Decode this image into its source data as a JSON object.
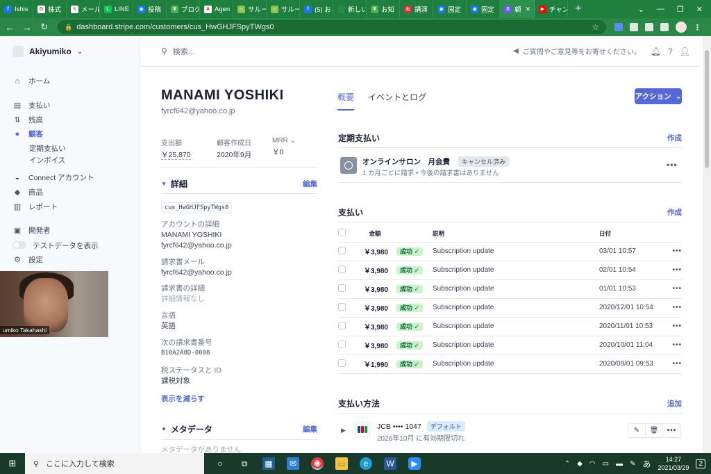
{
  "browser": {
    "tabs": [
      {
        "label": "Ishis",
        "fav_color": "#1877f2",
        "fav_glyph": "f"
      },
      {
        "label": "株式",
        "fav_color": "#ffffff",
        "fav_glyph": "G"
      },
      {
        "label": "メール",
        "fav_color": "#ffffff",
        "fav_glyph": "✎"
      },
      {
        "label": "LINE",
        "fav_color": "#06c755",
        "fav_glyph": "L"
      },
      {
        "label": "投稿",
        "fav_color": "#1877f2",
        "fav_glyph": "◉"
      },
      {
        "label": "ブログ",
        "fav_color": "#4caf50",
        "fav_glyph": "♜"
      },
      {
        "label": "Agen",
        "fav_color": "#ffffff",
        "fav_glyph": "A"
      },
      {
        "label": "サルー",
        "fav_color": "#8bc34a",
        "fav_glyph": "☺"
      },
      {
        "label": "サルー",
        "fav_color": "#8bc34a",
        "fav_glyph": "☺"
      },
      {
        "label": "(5) お",
        "fav_color": "#1877f2",
        "fav_glyph": "f"
      },
      {
        "label": "新しいタブ",
        "fav_color": "#2b8748",
        "fav_glyph": ""
      },
      {
        "label": "お知",
        "fav_color": "#4caf50",
        "fav_glyph": "♜"
      },
      {
        "label": "講演",
        "fav_color": "#d32f2f",
        "fav_glyph": "火"
      },
      {
        "label": "固定",
        "fav_color": "#1877f2",
        "fav_glyph": "◉"
      },
      {
        "label": "固定",
        "fav_color": "#1877f2",
        "fav_glyph": "◉"
      },
      {
        "label": "顧",
        "fav_color": "#635bff",
        "fav_glyph": "S",
        "active": true
      },
      {
        "label": "チャン",
        "fav_color": "#ff0000",
        "fav_glyph": "▶"
      }
    ],
    "new_tab": "+",
    "url": "dashboard.stripe.com/customers/cus_HwGHJFSpyTWgs0"
  },
  "sidebar": {
    "account": "Akiyumiko",
    "items": [
      {
        "label": "ホーム",
        "icon": "home-icon",
        "glyph": "⌂"
      },
      {
        "label": "支払い",
        "icon": "payments-icon",
        "glyph": "▤"
      },
      {
        "label": "残高",
        "icon": "balance-icon",
        "glyph": "⇅"
      },
      {
        "label": "顧客",
        "icon": "customers-icon",
        "glyph": "●",
        "active": true
      },
      {
        "label": "Connect アカウント",
        "icon": "connect-icon",
        "glyph": "◒"
      },
      {
        "label": "商品",
        "icon": "products-icon",
        "glyph": "◆"
      },
      {
        "label": "レポート",
        "icon": "reports-icon",
        "glyph": "▥"
      },
      {
        "label": "開発者",
        "icon": "developers-icon",
        "glyph": "▣"
      },
      {
        "label": "テストデータを表示",
        "icon": "toggle-icon",
        "glyph": ""
      },
      {
        "label": "設定",
        "icon": "settings-icon",
        "glyph": "⚙"
      }
    ],
    "subitems": [
      "定期支払い",
      "インボイス"
    ]
  },
  "video": {
    "caption": "umiko Takahashi"
  },
  "topbar": {
    "search_placeholder": "検索...",
    "feedback": "ご質問やご意見等をお寄せください。"
  },
  "customer": {
    "name": "MANAMI YOSHIKI",
    "email": "fyrcf642@yahoo.co.jp",
    "stats": [
      {
        "label": "支出額",
        "value": "￥25,870"
      },
      {
        "label": "顧客作成日",
        "value": "2020年9月"
      },
      {
        "label": "MRR",
        "value": "￥0"
      }
    ]
  },
  "details": {
    "heading": "詳細",
    "edit": "編集",
    "id": "cus_HwGHJFSpyTWgs0",
    "account_label": "アカウントの詳細",
    "account_name": "MANAMI YOSHIKI",
    "account_email": "fyrcf642@yahoo.co.jp",
    "invoice_email_label": "請求書メール",
    "invoice_email": "fyrcf642@yahoo.co.jp",
    "invoice_details_label": "請求書の詳細",
    "invoice_details": "詳細情報なし",
    "language_label": "言語",
    "language": "英語",
    "next_invoice_label": "次の請求書番号",
    "next_invoice": "B10A2A8D-0008",
    "tax_label": "税ステータスと ID",
    "tax": "課税対象",
    "show_less": "表示を減らす"
  },
  "metadata": {
    "heading": "メタデータ",
    "edit": "編集",
    "empty": "メタデータがありません"
  },
  "main_tabs": [
    "概要",
    "イベントとログ"
  ],
  "action_button": "アクション",
  "subscriptions": {
    "heading": "定期支払い",
    "create": "作成",
    "item_name": "オンラインサロン　月会費",
    "status": "キャンセル済み",
    "description": "1 カ月ごとに請求 • 今後の請求書はありません"
  },
  "payments": {
    "heading": "支払い",
    "create": "作成",
    "columns": [
      "金額",
      "説明",
      "日付"
    ],
    "rows": [
      {
        "amount": "￥3,980",
        "status": "成功",
        "description": "Subscription update",
        "date": "03/01 10:57"
      },
      {
        "amount": "￥3,980",
        "status": "成功",
        "description": "Subscription update",
        "date": "02/01 10:54"
      },
      {
        "amount": "￥3,980",
        "status": "成功",
        "description": "Subscription update",
        "date": "01/01 10:53"
      },
      {
        "amount": "￥3,980",
        "status": "成功",
        "description": "Subscription update",
        "date": "2020/12/01 10:54"
      },
      {
        "amount": "￥3,980",
        "status": "成功",
        "description": "Subscription update",
        "date": "2020/11/01 10:53"
      },
      {
        "amount": "￥3,980",
        "status": "成功",
        "description": "Subscription update",
        "date": "2020/10/01 11:04"
      },
      {
        "amount": "￥1,990",
        "status": "成功",
        "description": "Subscription update",
        "date": "2020/09/01 09:53"
      }
    ]
  },
  "payment_methods": {
    "heading": "支払い方法",
    "add": "追加",
    "card": "JCB •••• 1047",
    "default_badge": "デフォルト",
    "expiry": "2026年10月 に有効期限切れ"
  },
  "taskbar": {
    "search_placeholder": "ここに入力して検索",
    "time": "14:27",
    "date": "2021/03/29",
    "ime": "あ",
    "notifications": "2"
  }
}
